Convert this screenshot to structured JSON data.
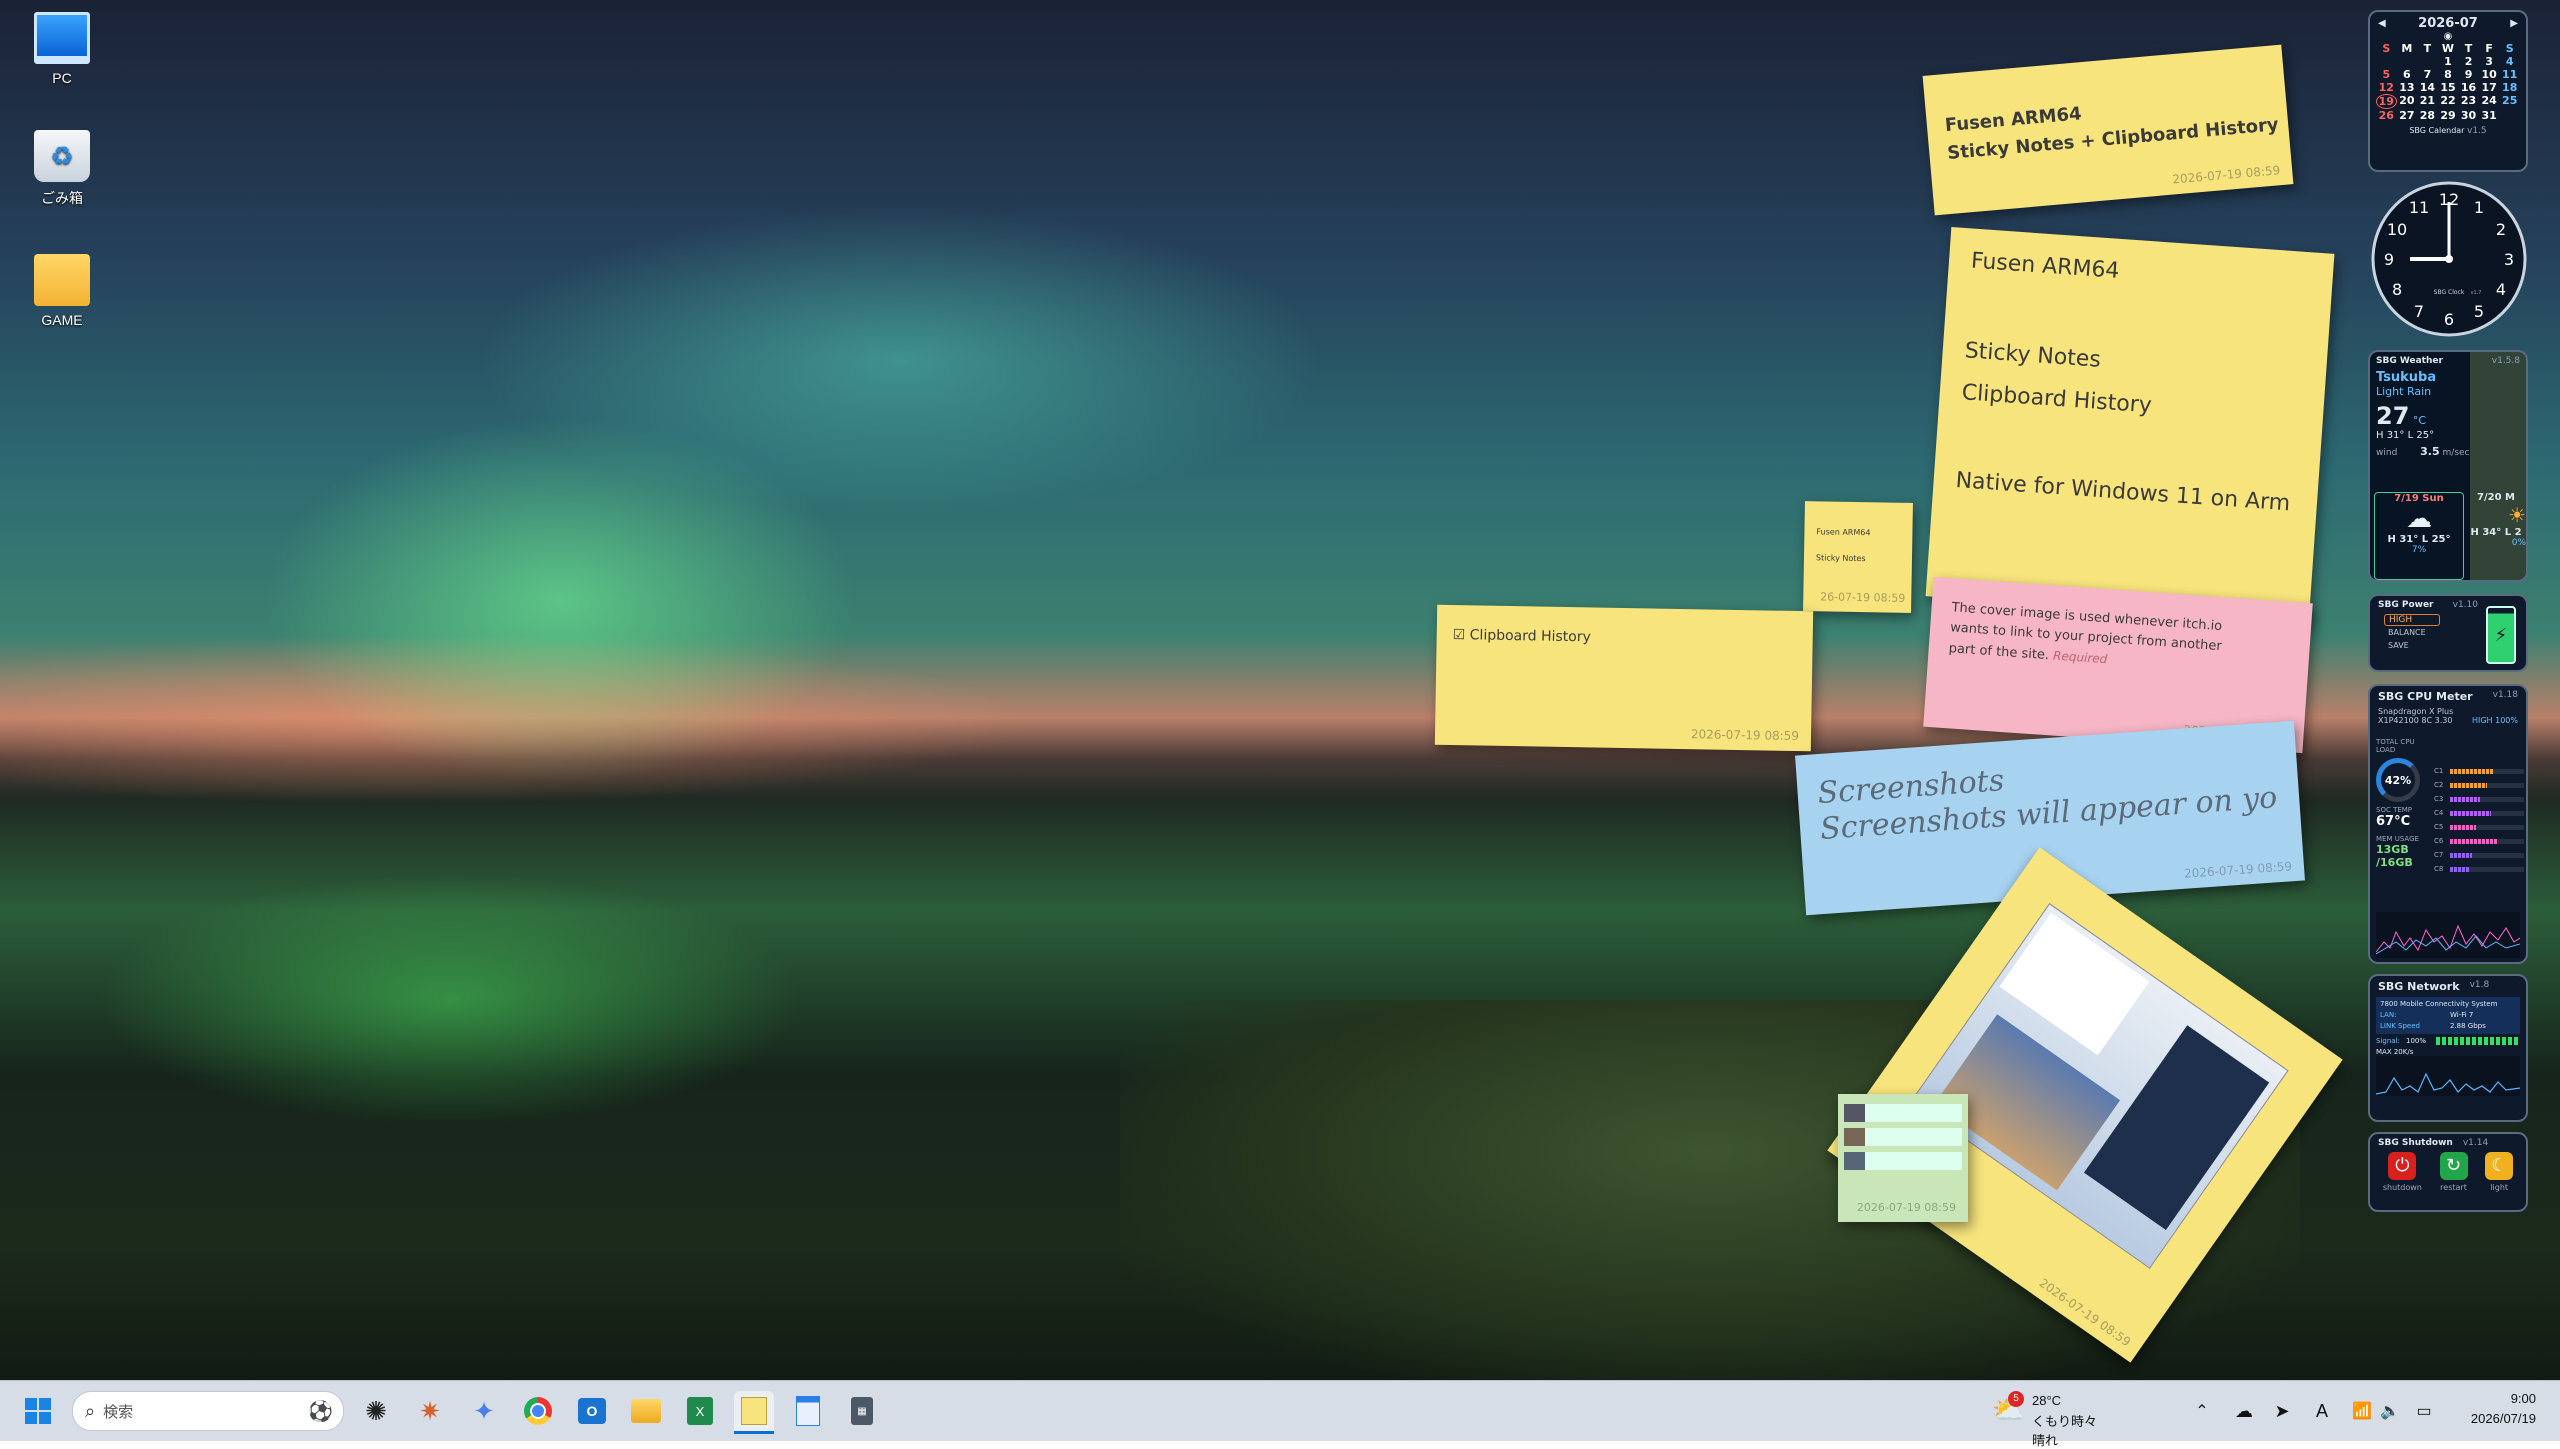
{
  "desktop": {
    "icons": [
      {
        "label": "PC",
        "icon": "monitor-icon"
      },
      {
        "label": "ごみ箱",
        "icon": "recycle-bin-icon"
      },
      {
        "label": "GAME",
        "icon": "folder-icon"
      }
    ]
  },
  "notes": {
    "n1": {
      "line1": "Fusen ARM64",
      "line2": "Sticky Notes + Clipboard History",
      "ts": "2026-07-19 08:59"
    },
    "n2": {
      "line1": "Fusen ARM64",
      "line2": "Sticky Notes",
      "line3": "Clipboard History",
      "line4": "Native for Windows 11 on Arm"
    },
    "n3": {
      "line1": "Fusen ARM64",
      "line2": "Sticky Notes",
      "ts": "26-07-19 08:59"
    },
    "n4": {
      "text": "☑ Clipboard History",
      "ts": "2026-07-19 08:59"
    },
    "n5": {
      "text": "The cover image is used whenever itch.io wants to link to your project from another part of the site.",
      "required": "Required",
      "ts": "2026-07-19 08:59"
    },
    "n6": {
      "line1": "Screenshots",
      "line2": "Screenshots will appear on yo",
      "ts": "2026-07-19 08:59"
    },
    "n7": {
      "ts": "2026-07-19 08:59"
    },
    "n8": {
      "ts": "2026-07-19 08:59"
    }
  },
  "calendar": {
    "month": "2026-07",
    "days_header": [
      "S",
      "M",
      "T",
      "W",
      "T",
      "F",
      "S"
    ],
    "weeks": [
      [
        "",
        "",
        "",
        "1",
        "2",
        "3",
        "4"
      ],
      [
        "5",
        "6",
        "7",
        "8",
        "9",
        "10",
        "11"
      ],
      [
        "12",
        "13",
        "14",
        "15",
        "16",
        "17",
        "18"
      ],
      [
        "19",
        "20",
        "21",
        "22",
        "23",
        "24",
        "25"
      ],
      [
        "26",
        "27",
        "28",
        "29",
        "30",
        "31",
        ""
      ]
    ],
    "today": "19",
    "footer": "SBG Calendar",
    "version": "v1.5"
  },
  "clock": {
    "numbers": [
      "12",
      "1",
      "2",
      "3",
      "4",
      "5",
      "6",
      "7",
      "8",
      "9",
      "10",
      "11"
    ],
    "label": "SBG Clock",
    "version": "v1.7",
    "hour": 9,
    "minute": 0
  },
  "weather": {
    "title": "SBG Weather",
    "version": "v1.5.8",
    "city": "Tsukuba",
    "condition": "Light Rain",
    "temp": "27",
    "temp_unit": "°C",
    "hilo": "H 31° L 25°",
    "wind_label": "wind",
    "wind": "3.5",
    "wind_unit": "m/sec",
    "day1": "7/19 Sun",
    "day1_hilo": "H 31° L 25°",
    "day1_pct": "7%",
    "day2": "7/20 M",
    "day2_hilo": "H 34° L 2",
    "day2_pct": "0%"
  },
  "power": {
    "title": "SBG Power",
    "version": "v1.10",
    "modes": [
      "HIGH",
      "BALANCE",
      "SAVE"
    ]
  },
  "cpu": {
    "title": "SBG CPU Meter",
    "version": "v1.18",
    "model": "Snapdragon X Plus",
    "model2": "X1P42100 8C 3.30",
    "high": "HIGH 100%",
    "total_label": "TOTAL CPU",
    "load_label": "LOAD",
    "load_pct": "42%",
    "soc_label": "SOC TEMP",
    "soc_temp": "67°C",
    "mem_label": "MEM USAGE",
    "mem": "13GB",
    "mem_total": "/16GB",
    "cores": [
      "C1",
      "C2",
      "C3",
      "C4",
      "C5",
      "C6",
      "C7",
      "C8"
    ],
    "core_loads": [
      0.6,
      0.5,
      0.4,
      0.55,
      0.35,
      0.65,
      0.3,
      0.25
    ]
  },
  "network": {
    "title": "SBG Network",
    "version": "v1.8",
    "adapter": "7800 Mobile Connectivity System",
    "lan_label": "LAN:",
    "lan": "Wi-Fi 7",
    "speed_label": "LINK Speed",
    "speed": "2.88 Gbps",
    "signal_label": "Signal:",
    "signal": "100%",
    "max": "MAX 20K/s"
  },
  "shutdown": {
    "title": "SBG Shutdown",
    "version": "v1.14",
    "buttons": [
      "shutdown",
      "restart",
      "light"
    ]
  },
  "taskbar": {
    "search_placeholder": "検索",
    "weather_badge": "5",
    "weather_temp": "28°C",
    "weather_desc": "くもり時々晴れ",
    "ime": "A",
    "time": "9:00",
    "date": "2026/07/19"
  }
}
